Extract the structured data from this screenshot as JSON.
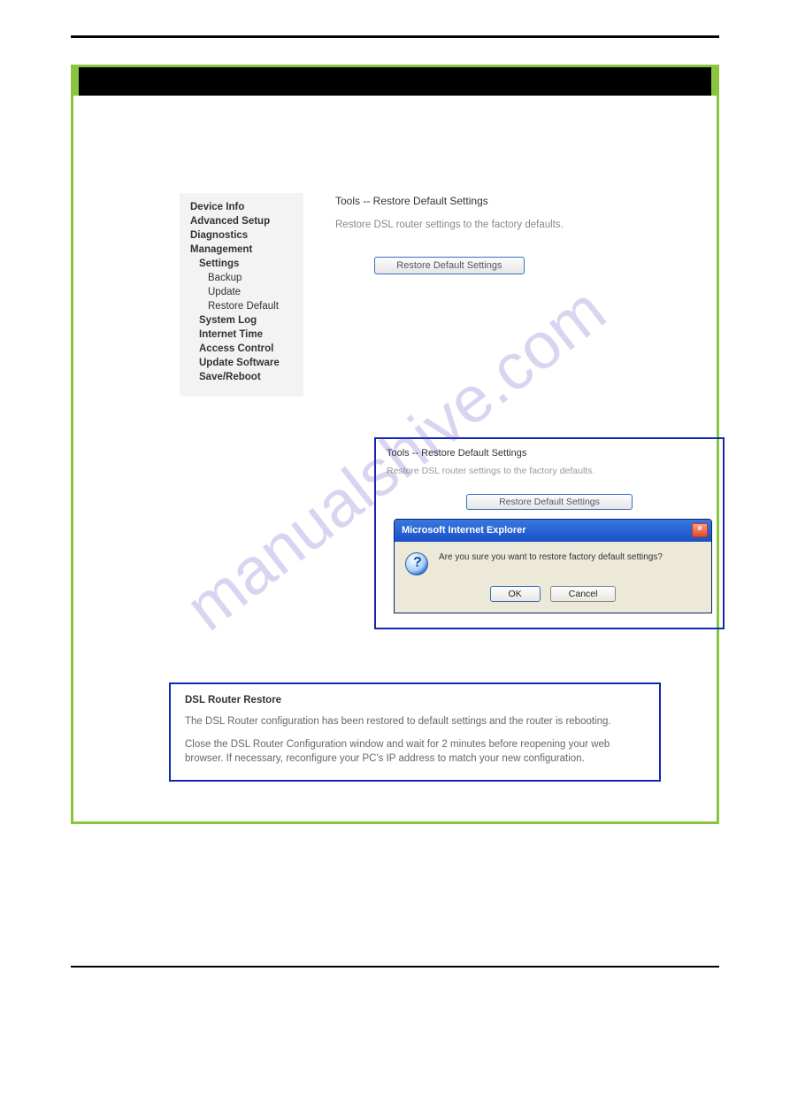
{
  "watermark": "manualshive.com",
  "sidebar": {
    "items": [
      {
        "label": "Device Info"
      },
      {
        "label": "Advanced Setup"
      },
      {
        "label": "Diagnostics"
      },
      {
        "label": "Management"
      },
      {
        "label": "Settings"
      },
      {
        "label": "Backup"
      },
      {
        "label": "Update"
      },
      {
        "label": "Restore Default"
      },
      {
        "label": "System Log"
      },
      {
        "label": "Internet Time"
      },
      {
        "label": "Access Control"
      },
      {
        "label": "Update Software"
      },
      {
        "label": "Save/Reboot"
      }
    ]
  },
  "pane1": {
    "title": "Tools -- Restore Default Settings",
    "desc": "Restore DSL router settings to the factory defaults.",
    "button": "Restore Default Settings"
  },
  "pane2": {
    "title": "Tools -- Restore Default Settings",
    "desc": "Restore DSL router settings to the factory defaults.",
    "button": "Restore Default Settings"
  },
  "dialog": {
    "title": "Microsoft Internet Explorer",
    "message": "Are you sure you want to restore factory default settings?",
    "ok": "OK",
    "cancel": "Cancel"
  },
  "restore": {
    "title": "DSL Router Restore",
    "p1": "The DSL Router configuration has been restored to default settings and the router is rebooting.",
    "p2": "Close the DSL Router Configuration window and wait for 2 minutes before reopening your web browser. If necessary, reconfigure your PC's IP address to match your new configuration."
  }
}
